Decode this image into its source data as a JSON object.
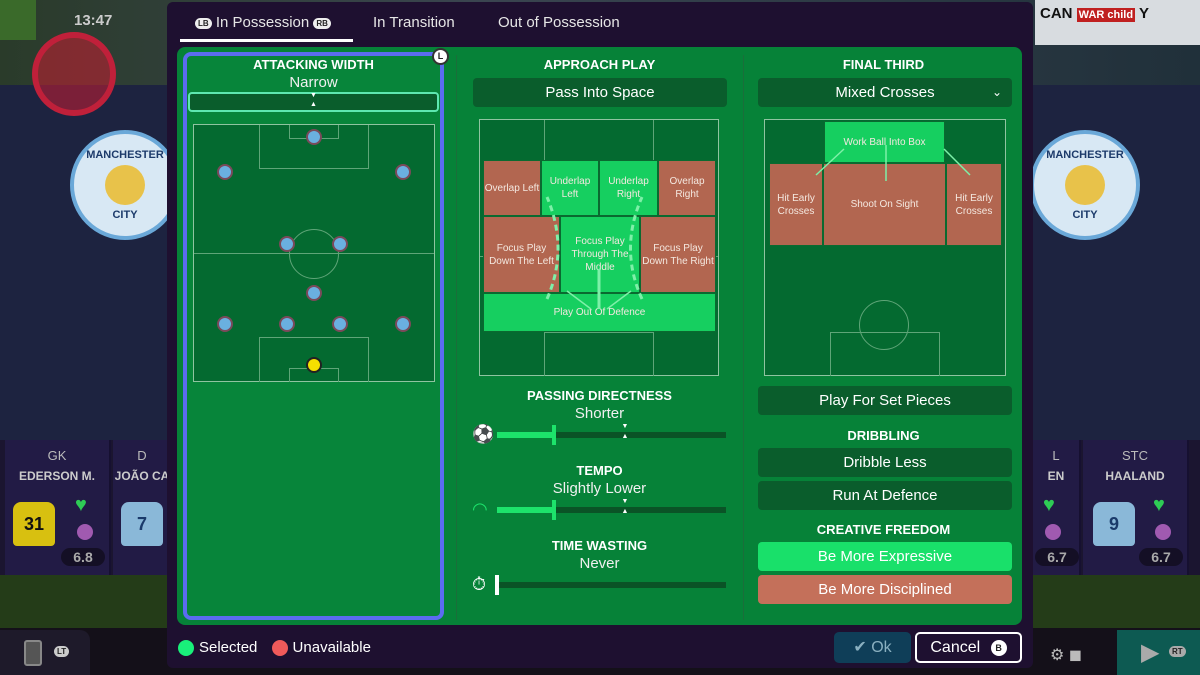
{
  "hud": {
    "clock": "13:47",
    "scoreboard": [
      "CAN",
      "WAR child",
      "Y"
    ]
  },
  "crest": {
    "line1": "MANCHESTER",
    "line2": "CITY"
  },
  "players": [
    {
      "pos": "GK",
      "name": "EDERSON M.",
      "number": "31",
      "rating": "6.8"
    },
    {
      "pos": "D",
      "name": "JOÃO CA",
      "number": "7"
    },
    {
      "pos": "L",
      "name": "EN",
      "rating": "6.7"
    },
    {
      "pos": "STC",
      "name": "HAALAND",
      "number": "9",
      "rating": "6.7"
    }
  ],
  "tabs": [
    {
      "label": "In Possession",
      "left_badge": "LB",
      "right_badge": "RB",
      "active": true
    },
    {
      "label": "In Transition"
    },
    {
      "label": "Out of Possession"
    }
  ],
  "attacking_width": {
    "title": "ATTACKING WIDTH",
    "value": "Narrow",
    "badge": "L"
  },
  "approach_play": {
    "title": "APPROACH PLAY",
    "selected": "Pass Into Space",
    "zones": [
      {
        "label": "Overlap Left",
        "state": "unavailable"
      },
      {
        "label": "Underlap Left",
        "state": "selected"
      },
      {
        "label": "Underlap Right",
        "state": "selected"
      },
      {
        "label": "Overlap Right",
        "state": "unavailable"
      },
      {
        "label": "Focus Play Down The Left",
        "state": "unavailable"
      },
      {
        "label": "Focus Play Through The Middle",
        "state": "selected"
      },
      {
        "label": "Focus Play Down The Right",
        "state": "unavailable"
      },
      {
        "label": "Play Out Of Defence",
        "state": "selected"
      }
    ]
  },
  "passing_directness": {
    "title": "PASSING DIRECTNESS",
    "value": "Shorter",
    "level": 0.25,
    "icon": "football-icon"
  },
  "tempo": {
    "title": "TEMPO",
    "value": "Slightly Lower",
    "level": 0.25,
    "icon": "gauge-icon"
  },
  "time_wasting": {
    "title": "TIME WASTING",
    "value": "Never",
    "level": 0,
    "icon": "stopwatch-icon"
  },
  "final_third": {
    "title": "FINAL THIRD",
    "selected": "Mixed Crosses",
    "zones": [
      {
        "label": "Work Ball Into Box",
        "state": "selected"
      },
      {
        "label": "Hit Early Crosses",
        "state": "unavailable"
      },
      {
        "label": "Shoot On Sight",
        "state": "unavailable"
      },
      {
        "label": "Hit Early Crosses",
        "state": "unavailable"
      }
    ]
  },
  "set_pieces": "Play For Set Pieces",
  "dribbling": {
    "title": "DRIBBLING",
    "options": [
      "Dribble Less",
      "Run At Defence"
    ]
  },
  "creative_freedom": {
    "title": "CREATIVE FREEDOM",
    "options": [
      {
        "label": "Be More Expressive",
        "state": "selected"
      },
      {
        "label": "Be More Disciplined",
        "state": "unavailable"
      }
    ]
  },
  "legend": {
    "selected": "Selected",
    "unavailable": "Unavailable"
  },
  "footer": {
    "ok": "Ok",
    "cancel": "Cancel",
    "cancel_badge": "B",
    "lt": "LT",
    "rt": "RT"
  },
  "colors": {
    "selected": "#16cf60",
    "unavailable": "#b26650",
    "panel": "#068238",
    "focus": "#5b6cf0"
  }
}
